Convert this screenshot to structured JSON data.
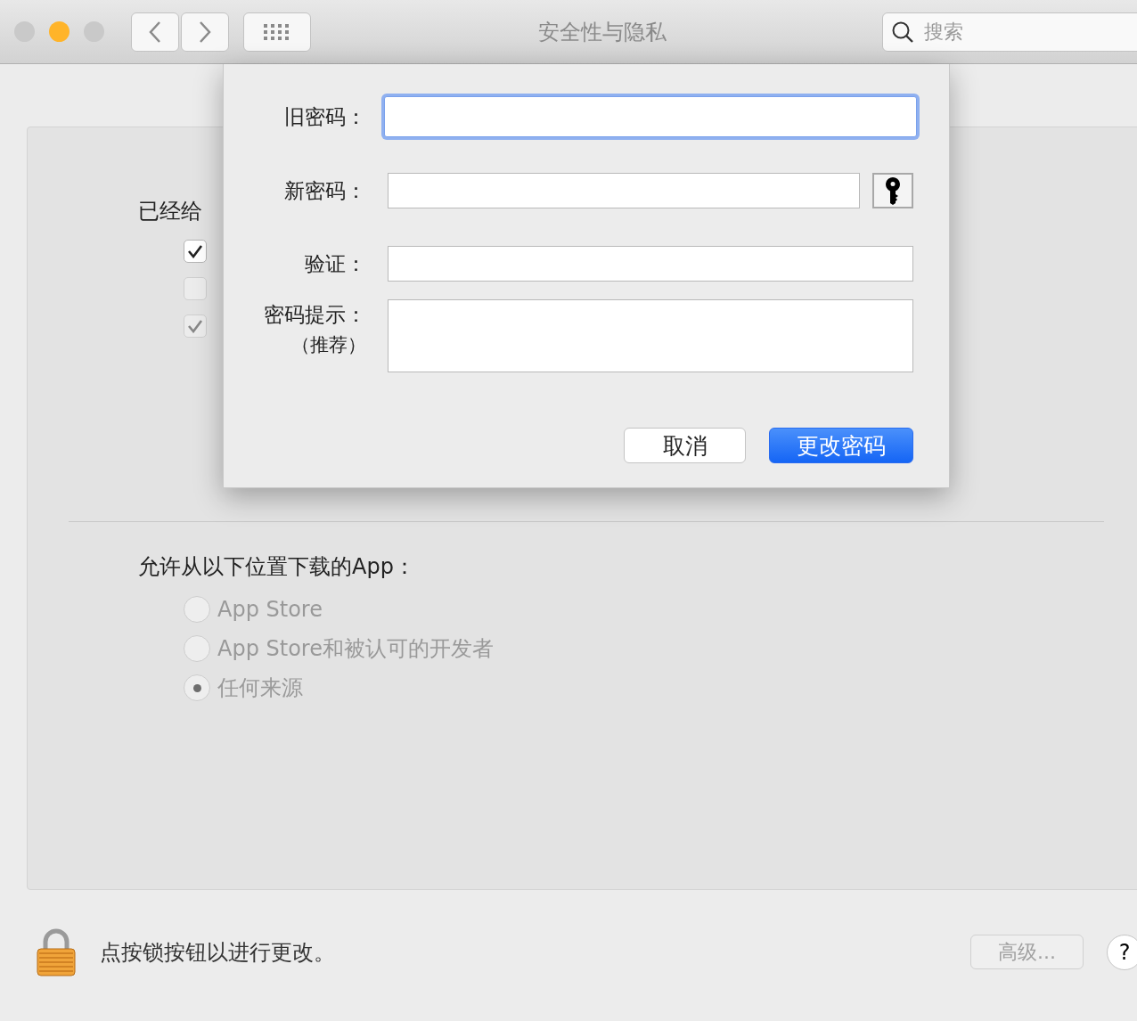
{
  "window": {
    "title": "安全性与隐私",
    "search": {
      "placeholder": "搜索"
    }
  },
  "traffic_lights": [
    {
      "color": "#c9c9c9"
    },
    {
      "color": "#ffb429"
    },
    {
      "color": "#c9c9c9"
    }
  ],
  "background": {
    "heading": "已经给",
    "checkboxes": [
      {
        "checked": true,
        "disabled": false
      },
      {
        "checked": false,
        "disabled": true
      },
      {
        "checked": true,
        "disabled": true
      }
    ],
    "download_heading": "允许从以下位置下载的App：",
    "sources": [
      {
        "label": "App Store",
        "selected": false,
        "disabled": true
      },
      {
        "label": "App Store和被认可的开发者",
        "selected": false,
        "disabled": true
      },
      {
        "label": "任何来源",
        "selected": true,
        "disabled": true
      }
    ]
  },
  "footer": {
    "lock_note": "点按锁按钮以进行更改。",
    "advanced_button": {
      "label": "高级...",
      "disabled": true
    },
    "help_button": "?"
  },
  "sheet": {
    "fields": [
      {
        "label": "旧密码：",
        "kind": "text",
        "focused": true
      },
      {
        "label": "新密码：",
        "kind": "password_with_assistant",
        "focused": false
      },
      {
        "label": "验证：",
        "kind": "text",
        "focused": false
      },
      {
        "label": "密码提示：",
        "note": "（推荐）",
        "kind": "multiline",
        "focused": false
      }
    ],
    "buttons": [
      {
        "label": "取消",
        "primary": false
      },
      {
        "label": "更改密码",
        "primary": true
      }
    ]
  }
}
